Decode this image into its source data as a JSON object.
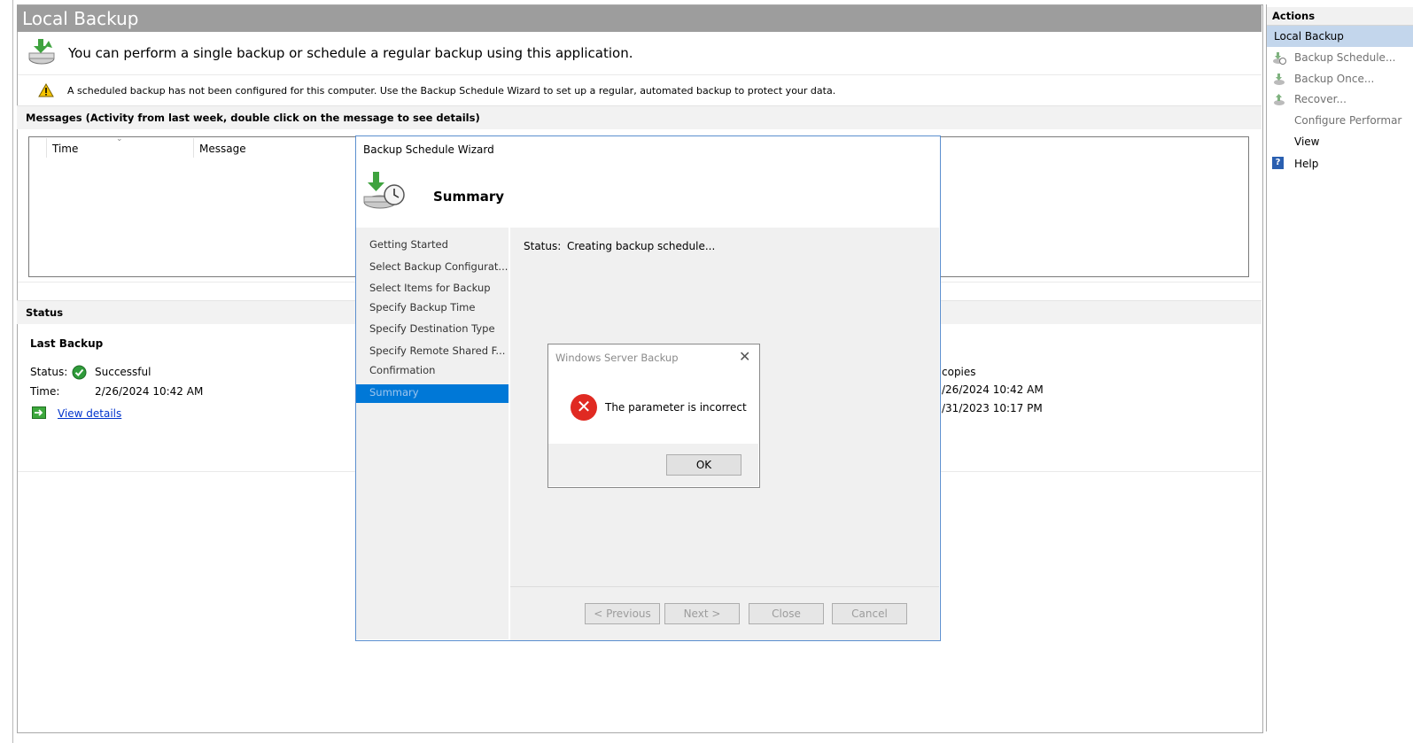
{
  "window": {
    "title": "Local Backup"
  },
  "info": {
    "text": "You can perform a single backup or schedule a regular backup using this application."
  },
  "warning": {
    "text": "A scheduled backup has not been configured for this computer. Use the Backup Schedule Wizard to set up a regular, automated backup to protect your data."
  },
  "messages": {
    "header": "Messages (Activity from last week, double click on the message to see details)",
    "columns": [
      "Time",
      "Message"
    ]
  },
  "status_section": {
    "header": "Status",
    "last_backup": {
      "title": "Last Backup",
      "status_label": "Status:",
      "status_value": "Successful",
      "time_label": "Time:",
      "time_value": "2/26/2024 10:42 AM",
      "view_details": "View details"
    },
    "right_partial": {
      "copies": "copies",
      "latest": "/26/2024 10:42 AM",
      "oldest": "/31/2023 10:17 PM"
    }
  },
  "actions": {
    "header": "Actions",
    "section": "Local Backup",
    "items": [
      "Backup Schedule...",
      "Backup Once...",
      "Recover...",
      "Configure Performar",
      "View",
      "Help"
    ]
  },
  "wizard": {
    "title": "Backup Schedule Wizard",
    "heading": "Summary",
    "nav": [
      "Getting Started",
      "Select Backup Configurat...",
      "Select Items for Backup",
      "Specify Backup Time",
      "Specify Destination Type",
      "Specify Remote Shared F...",
      "Confirmation",
      "Summary"
    ],
    "status_label": "Status:",
    "status_value": "Creating backup schedule...",
    "buttons": {
      "previous": "< Previous",
      "next": "Next >",
      "close": "Close",
      "cancel": "Cancel"
    }
  },
  "dialog": {
    "title": "Windows Server Backup",
    "message": "The parameter is incorrect",
    "ok": "OK",
    "close_glyph": "✕",
    "error_glyph": "✕"
  },
  "colors": {
    "selected": "#0078d7",
    "actions_selected": "#c3d6ec",
    "title_bar": "#9d9d9d",
    "error": "#e02a22"
  }
}
